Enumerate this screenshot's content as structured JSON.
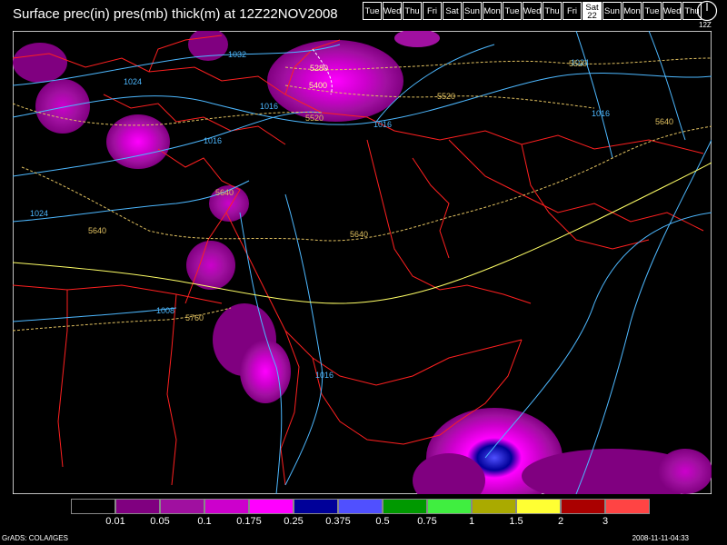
{
  "header": {
    "title": "Surface prec(in) pres(mb) thick(m) at 12Z22NOV2008",
    "days": [
      {
        "label": "Tue"
      },
      {
        "label": "Wed"
      },
      {
        "label": "Thu"
      },
      {
        "label": "Fri"
      },
      {
        "label": "Sat"
      },
      {
        "label": "Sun"
      },
      {
        "label": "Mon"
      },
      {
        "label": "Tue"
      },
      {
        "label": "Wed"
      },
      {
        "label": "Thu"
      },
      {
        "label": "Fri"
      },
      {
        "label": "Sat",
        "sub": "22",
        "selected": true
      },
      {
        "label": "Sun"
      },
      {
        "label": "Mon"
      },
      {
        "label": "Tue"
      },
      {
        "label": "Wed"
      },
      {
        "label": "Thu"
      }
    ],
    "clock_label": "12Z"
  },
  "map": {
    "isobar_labels": [
      "1032",
      "1024",
      "1024",
      "1016",
      "1016",
      "1016",
      "1016",
      "1008",
      "1016",
      "1024"
    ],
    "thickness_labels": [
      "5280",
      "5400",
      "5520",
      "5520",
      "5640",
      "5640",
      "5640",
      "5640",
      "5760",
      "5520"
    ]
  },
  "legend": {
    "colors": [
      "#000000",
      "#800080",
      "#a010a0",
      "#cc00cc",
      "#ff00ff",
      "#000099",
      "#5050ff",
      "#009900",
      "#40ee40",
      "#aaaa00",
      "#ffff33",
      "#aa0000",
      "#ff4444"
    ],
    "labels": [
      "0.01",
      "0.05",
      "0.1",
      "0.175",
      "0.25",
      "0.375",
      "0.5",
      "0.75",
      "1",
      "1.5",
      "2",
      "3"
    ]
  },
  "footer": {
    "left": "GrADS: COLA/IGES",
    "right": "2008-11-11-04:33"
  }
}
